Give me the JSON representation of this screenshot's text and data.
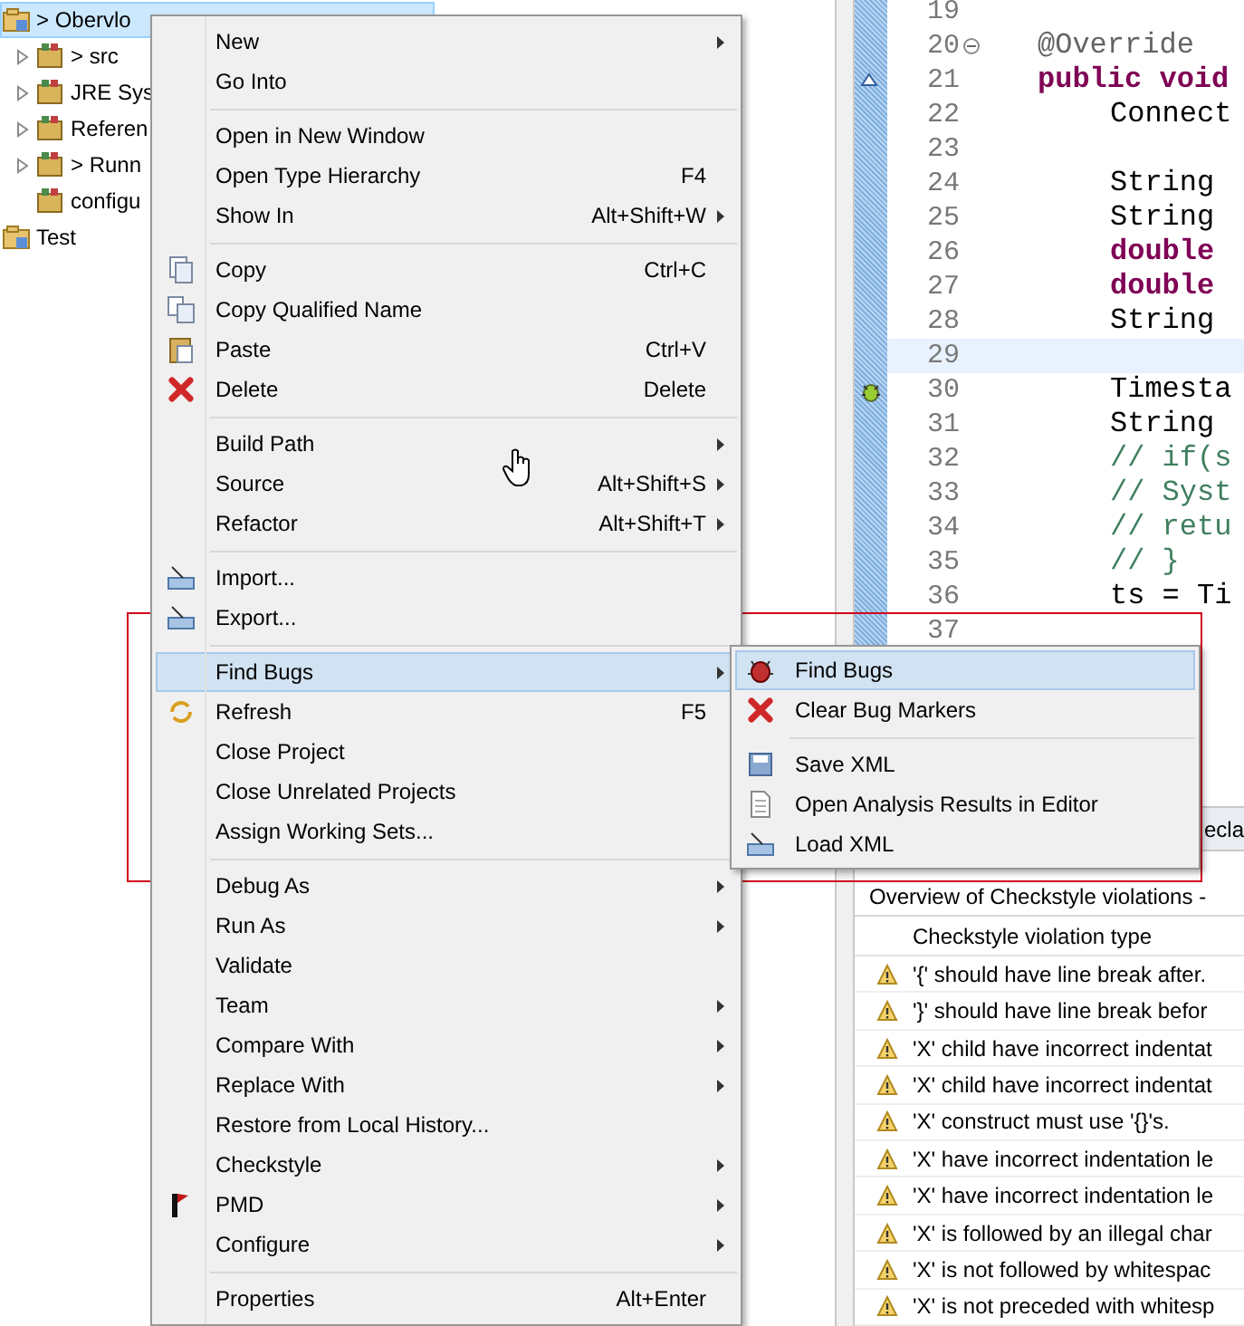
{
  "tree": [
    {
      "label": "> Obervlo",
      "selected": true,
      "children": [
        {
          "label": "> src",
          "expanded": false
        },
        {
          "label": "JRE Sys",
          "expanded": false
        },
        {
          "label": "Referen",
          "expanded": false
        },
        {
          "label": "> Runn",
          "expanded": false
        },
        {
          "label": "configu"
        }
      ]
    },
    {
      "label": "Test",
      "selected": false
    }
  ],
  "editor": {
    "lines": [
      {
        "number": "19",
        "current": false
      },
      {
        "number": "20",
        "code": "@Override",
        "kind": "annotation",
        "indented": false,
        "current": false
      },
      {
        "number": "21",
        "code": "public void",
        "kind": "keyword",
        "indented": false,
        "current": false
      },
      {
        "number": "22",
        "code": "Connect",
        "kind": "plain",
        "indented": true,
        "current": false
      },
      {
        "number": "23",
        "current": false
      },
      {
        "number": "24",
        "code": "String",
        "kind": "plain",
        "indented": true,
        "current": false
      },
      {
        "number": "25",
        "code": "String",
        "kind": "plain",
        "indented": true,
        "current": false
      },
      {
        "number": "26",
        "code": "double",
        "kind": "keyword",
        "indented": true,
        "current": false
      },
      {
        "number": "27",
        "code": "double",
        "kind": "keyword",
        "indented": true,
        "current": false
      },
      {
        "number": "28",
        "code": "String",
        "kind": "plain",
        "indented": true,
        "current": false
      },
      {
        "number": "29",
        "current": true
      },
      {
        "number": "30",
        "code": "Timesta",
        "kind": "plain",
        "indented": true,
        "current": false
      },
      {
        "number": "31",
        "code": "String",
        "kind": "plain",
        "indented": true,
        "current": false
      },
      {
        "number": "32",
        "code": "// if(s",
        "kind": "comment",
        "indented": true,
        "current": false
      },
      {
        "number": "33",
        "code": "// Syst",
        "kind": "comment",
        "indented": true,
        "current": false
      },
      {
        "number": "34",
        "code": "// retu",
        "kind": "comment",
        "indented": true,
        "current": false
      },
      {
        "number": "35",
        "code": "// }",
        "kind": "comment",
        "indented": true,
        "current": false
      },
      {
        "number": "36",
        "code": "ts = Ti",
        "kind": "plain",
        "indented": true,
        "current": false
      },
      {
        "number": "37",
        "current": false
      }
    ]
  },
  "bottom_panel": {
    "tab": "ecla",
    "title": "Overview of Checkstyle violations -",
    "column": "Checkstyle violation type",
    "rows": [
      "'{' should have line break after.",
      "'}' should have line break befor",
      "'X' child have incorrect indentat",
      "'X' child have incorrect indentat",
      "'X' construct must use '{}'s.",
      "'X' have incorrect indentation le",
      "'X' have incorrect indentation le",
      "'X' is followed by an illegal char",
      "'X' is not followed by whitespac",
      "'X' is not preceded with whitesp"
    ]
  },
  "context_menu": {
    "items": [
      {
        "kind": "item",
        "label": "New",
        "submenu": true,
        "selected": false
      },
      {
        "kind": "item",
        "label": "Go Into",
        "submenu": false,
        "selected": false
      },
      {
        "kind": "separator"
      },
      {
        "kind": "item",
        "label": "Open in New Window",
        "submenu": false,
        "selected": false
      },
      {
        "kind": "item",
        "label": "Open Type Hierarchy",
        "shortcut": "F4",
        "submenu": false,
        "selected": false
      },
      {
        "kind": "item",
        "label": "Show In",
        "shortcut": "Alt+Shift+W",
        "submenu": true,
        "selected": false
      },
      {
        "kind": "separator"
      },
      {
        "kind": "item",
        "label": "Copy",
        "shortcut": "Ctrl+C",
        "submenu": false,
        "selected": false
      },
      {
        "kind": "item",
        "label": "Copy Qualified Name",
        "submenu": false,
        "selected": false
      },
      {
        "kind": "item",
        "label": "Paste",
        "shortcut": "Ctrl+V",
        "submenu": false,
        "selected": false
      },
      {
        "kind": "item",
        "label": "Delete",
        "shortcut": "Delete",
        "submenu": false,
        "selected": false
      },
      {
        "kind": "separator"
      },
      {
        "kind": "item",
        "label": "Build Path",
        "submenu": true,
        "selected": false
      },
      {
        "kind": "item",
        "label": "Source",
        "shortcut": "Alt+Shift+S",
        "submenu": true,
        "selected": false
      },
      {
        "kind": "item",
        "label": "Refactor",
        "shortcut": "Alt+Shift+T",
        "submenu": true,
        "selected": false
      },
      {
        "kind": "separator"
      },
      {
        "kind": "item",
        "label": "Import...",
        "submenu": false,
        "selected": false
      },
      {
        "kind": "item",
        "label": "Export...",
        "submenu": false,
        "selected": false
      },
      {
        "kind": "separator"
      },
      {
        "kind": "item",
        "label": "Find Bugs",
        "submenu": true,
        "selected": true
      },
      {
        "kind": "item",
        "label": "Refresh",
        "shortcut": "F5",
        "submenu": false,
        "selected": false
      },
      {
        "kind": "item",
        "label": "Close Project",
        "submenu": false,
        "selected": false
      },
      {
        "kind": "item",
        "label": "Close Unrelated Projects",
        "submenu": false,
        "selected": false
      },
      {
        "kind": "item",
        "label": "Assign Working Sets...",
        "submenu": false,
        "selected": false
      },
      {
        "kind": "separator"
      },
      {
        "kind": "item",
        "label": "Debug As",
        "submenu": true,
        "selected": false
      },
      {
        "kind": "item",
        "label": "Run As",
        "submenu": true,
        "selected": false
      },
      {
        "kind": "item",
        "label": "Validate",
        "submenu": false,
        "selected": false
      },
      {
        "kind": "item",
        "label": "Team",
        "submenu": true,
        "selected": false
      },
      {
        "kind": "item",
        "label": "Compare With",
        "submenu": true,
        "selected": false
      },
      {
        "kind": "item",
        "label": "Replace With",
        "submenu": true,
        "selected": false
      },
      {
        "kind": "item",
        "label": "Restore from Local History...",
        "submenu": false,
        "selected": false
      },
      {
        "kind": "item",
        "label": "Checkstyle",
        "submenu": true,
        "selected": false
      },
      {
        "kind": "item",
        "label": "PMD",
        "submenu": true,
        "selected": false
      },
      {
        "kind": "item",
        "label": "Configure",
        "submenu": true,
        "selected": false
      },
      {
        "kind": "separator"
      },
      {
        "kind": "item",
        "label": "Properties",
        "shortcut": "Alt+Enter",
        "submenu": false,
        "selected": false
      }
    ]
  },
  "submenu": {
    "items": [
      {
        "kind": "item",
        "label": "Find Bugs",
        "selected": true
      },
      {
        "kind": "item",
        "label": "Clear Bug Markers",
        "selected": false
      },
      {
        "kind": "separator"
      },
      {
        "kind": "item",
        "label": "Save XML",
        "selected": false
      },
      {
        "kind": "item",
        "label": "Open Analysis Results in Editor",
        "selected": false
      },
      {
        "kind": "item",
        "label": "Load XML",
        "selected": false
      }
    ]
  }
}
